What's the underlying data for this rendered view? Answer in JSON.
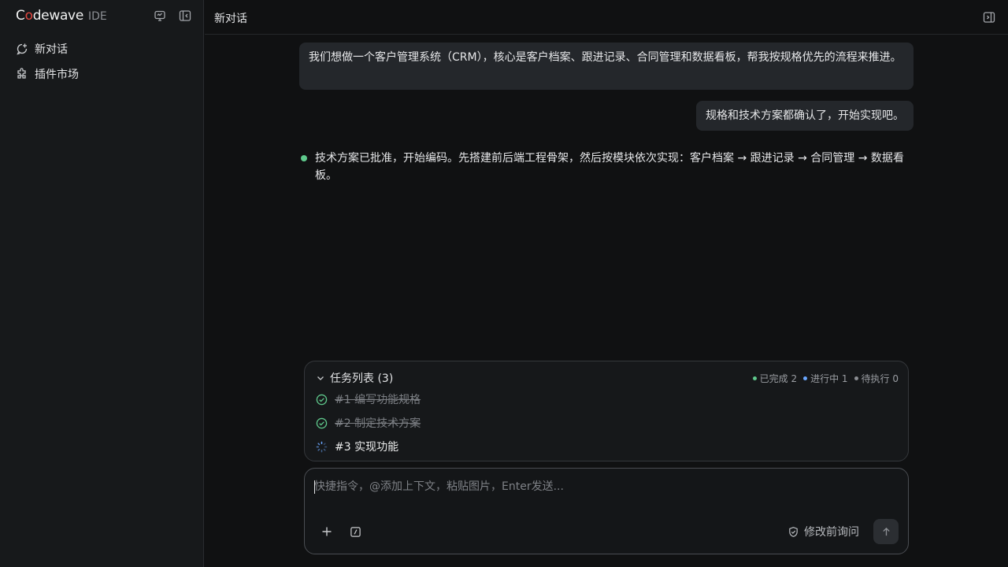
{
  "sidebar": {
    "brand_prefix": "C",
    "brand_o": "o",
    "brand_suffix": "dewave",
    "brand_tag": "IDE",
    "items": [
      {
        "label": "新对话",
        "icon": "new-chat-icon"
      },
      {
        "label": "插件市场",
        "icon": "puzzle-icon"
      }
    ],
    "top_icons": [
      "monitor-chat-icon",
      "collapse-sidebar-icon"
    ]
  },
  "header": {
    "title": "新对话",
    "right_icon": "expand-panel-icon"
  },
  "conversation": {
    "user_message_1": "我们想做一个客户管理系统（CRM），核心是客户档案、跟进记录、合同管理和数据看板，帮我按规格优先的流程来推进。",
    "user_message_2": "规格和技术方案都确认了，开始实现吧。",
    "assistant_message": "技术方案已批准，开始编码。先搭建前后端工程骨架，然后按模块依次实现：客户档案 → 跟进记录 → 合同管理 → 数据看板。"
  },
  "tasks": {
    "title": "任务列表 (3)",
    "stats": [
      {
        "label": "已完成 2",
        "color": "#5fc98c"
      },
      {
        "label": "进行中 1",
        "color": "#6aa7ff"
      },
      {
        "label": "待执行 0",
        "color": "#8b8e93"
      }
    ],
    "items": [
      {
        "label": "#1 编写功能规格",
        "status": "done"
      },
      {
        "label": "#2 制定技术方案",
        "status": "done"
      },
      {
        "label": "#3 实现功能",
        "status": "in-progress"
      }
    ]
  },
  "composer": {
    "placeholder": "快捷指令，@添加上下文，粘贴图片，Enter发送...",
    "value": "",
    "mode_label": "修改前询问"
  },
  "colors": {
    "accent_green": "#5fc98c",
    "brand_red": "#e0463f",
    "background": "#101112",
    "sidebar": "#17191b"
  }
}
